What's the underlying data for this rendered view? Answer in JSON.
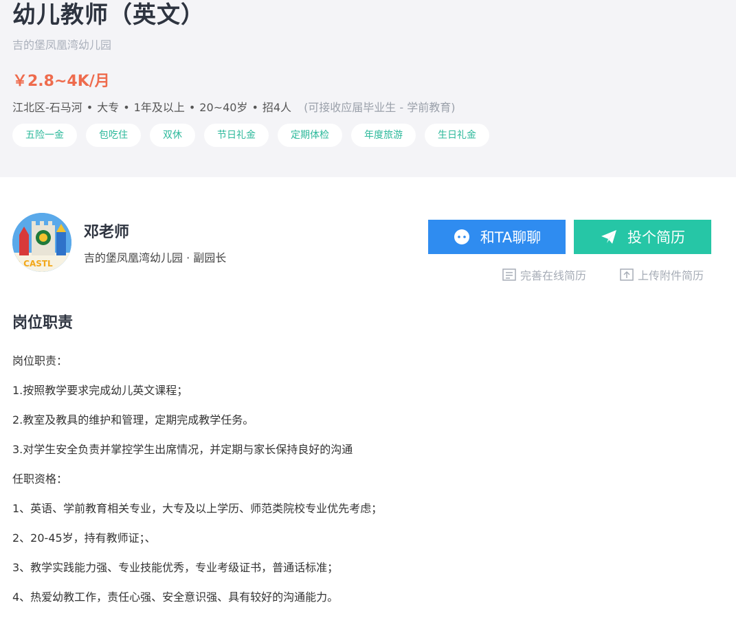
{
  "job": {
    "title": "幼儿教师（英文）",
    "company": "吉的堡凤凰湾幼儿园",
    "salary": "￥2.8~4K/月",
    "requirements": [
      "江北区-石马河",
      "大专",
      "1年及以上",
      "20~40岁",
      "招4人"
    ],
    "requirements_extra": "(可接收应届毕业生 - 学前教育)",
    "tags": [
      "五险一金",
      "包吃住",
      "双休",
      "节日礼金",
      "定期体检",
      "年度旅游",
      "生日礼金"
    ]
  },
  "recruiter": {
    "name": "邓老师",
    "role": "吉的堡凤凰湾幼儿园 · 副园长",
    "avatar_text": "D CASTL"
  },
  "actions": {
    "chat_label": "和TA聊聊",
    "resume_label": "投个简历",
    "complete_resume_label": "完善在线简历",
    "upload_resume_label": "上传附件简历"
  },
  "description": {
    "title": "岗位职责",
    "lines": [
      "岗位职责：",
      "1.按照教学要求完成幼儿英文课程；",
      "2.教室及教具的维护和管理，定期完成教学任务。",
      "3.对学生安全负责并掌控学生出席情况，并定期与家长保持良好的沟通",
      "任职资格：",
      "1、英语、学前教育相关专业，大专及以上学历、师范类院校专业优先考虑；",
      "2、20-45岁，持有教师证；、",
      "3、教学实践能力强、专业技能优秀，专业考级证书，普通话标准；",
      "4、热爱幼教工作，责任心强、安全意识强、具有较好的沟通能力。"
    ]
  },
  "colors": {
    "header_bg": "#f4f4f7",
    "salary": "#ee6b4d",
    "tag_text": "#2bb89a",
    "chat_button": "#2f8cf0",
    "resume_button": "#26c6a6"
  },
  "icons": {
    "chat": "chat-bubble-icon",
    "resume": "paper-plane-icon",
    "complete": "document-icon",
    "upload": "upload-icon"
  }
}
